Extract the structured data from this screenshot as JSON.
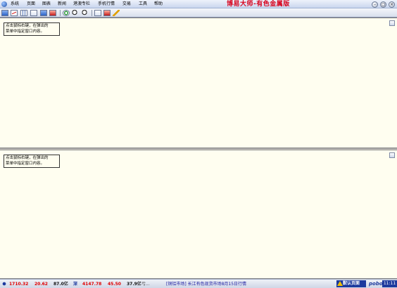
{
  "menubar": {
    "items": [
      "系统",
      "页面",
      "图表",
      "新闻",
      "港澳专栏",
      "手机行情",
      "交易",
      "工具",
      "帮助"
    ],
    "brand": "博易大师-有色金属版",
    "window_buttons": [
      "minimize-icon",
      "restore-icon",
      "close-icon"
    ]
  },
  "toolbar": {
    "icons": [
      "home-icon",
      "line-chart-icon",
      "table-icon",
      "grid-icon",
      "window-icon",
      "excel-icon",
      "refresh-icon",
      "zoom-in-icon",
      "zoom-out-icon",
      "settings-icon",
      "alert-icon",
      "pen-icon"
    ]
  },
  "panels": {
    "top": {
      "hint_line1": "点击鼠标右键，在弹出的",
      "hint_line2": "菜单中指定窗口内容。"
    },
    "bottom": {
      "hint_line1": "点击鼠标右键，在弹出的",
      "hint_line2": "菜单中指定窗口内容。"
    }
  },
  "statusbar": {
    "index1_value": "1710.32",
    "index1_change": "20.62",
    "index1_volume": "87.0亿",
    "index2_label": "深",
    "index2_value": "4147.78",
    "index2_change": "45.50",
    "index2_volume": "37.9亿",
    "index2_suffix": "亏...",
    "ticker": "[铜铝市场]  长江有色现货市场8月15日行情",
    "badge": "默认页面",
    "logo": "pobo",
    "clock": "11:11"
  },
  "colors": {
    "brand_red": "#d8001a",
    "up_red": "#e00000",
    "panel_bg": "#fffef0",
    "status_blue": "#1d3a9e"
  }
}
